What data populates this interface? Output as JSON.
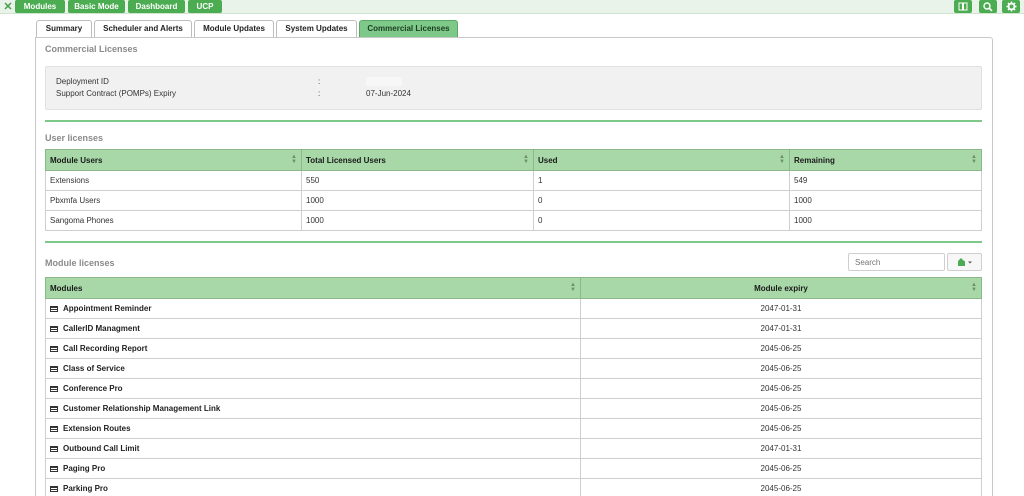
{
  "topnav": {
    "buttons": [
      "Modules",
      "Basic Mode",
      "Dashboard",
      "UCP"
    ]
  },
  "tabs": [
    "Summary",
    "Scheduler and Alerts",
    "Module Updates",
    "System Updates",
    "Commercial Licenses"
  ],
  "commercial": {
    "title": "Commercial Licenses",
    "rows": [
      {
        "label": "Deployment ID",
        "sep": ":",
        "value": ""
      },
      {
        "label": "Support Contract (POMPs) Expiry",
        "sep": ":",
        "value": "07-Jun-2024"
      }
    ]
  },
  "user_licenses": {
    "title": "User licenses",
    "headers": [
      "Module Users",
      "Total Licensed Users",
      "Used",
      "Remaining"
    ],
    "rows": [
      [
        "Extensions",
        "550",
        "1",
        "549"
      ],
      [
        "Pbxmfa Users",
        "1000",
        "0",
        "1000"
      ],
      [
        "Sangoma Phones",
        "1000",
        "0",
        "1000"
      ]
    ]
  },
  "module_licenses": {
    "title": "Module licenses",
    "search_placeholder": "Search",
    "headers": [
      "Modules",
      "Module expiry"
    ],
    "rows": [
      [
        "Appointment Reminder",
        "2047-01-31"
      ],
      [
        "CallerID Managment",
        "2047-01-31"
      ],
      [
        "Call Recording Report",
        "2045-06-25"
      ],
      [
        "Class of Service",
        "2045-06-25"
      ],
      [
        "Conference Pro",
        "2045-06-25"
      ],
      [
        "Customer Relationship Management Link",
        "2045-06-25"
      ],
      [
        "Extension Routes",
        "2045-06-25"
      ],
      [
        "Outbound Call Limit",
        "2047-01-31"
      ],
      [
        "Paging Pro",
        "2045-06-25"
      ],
      [
        "Parking Pro",
        "2045-06-25"
      ]
    ]
  },
  "colors": {
    "accent": "#4cac52",
    "header": "#a8d8a8",
    "active_tab": "#7ec98a"
  },
  "icons": {
    "close": "close-icon",
    "book": "book-icon",
    "search": "search-icon",
    "gear": "gear-icon",
    "export": "export-icon",
    "module": "module-icon"
  }
}
